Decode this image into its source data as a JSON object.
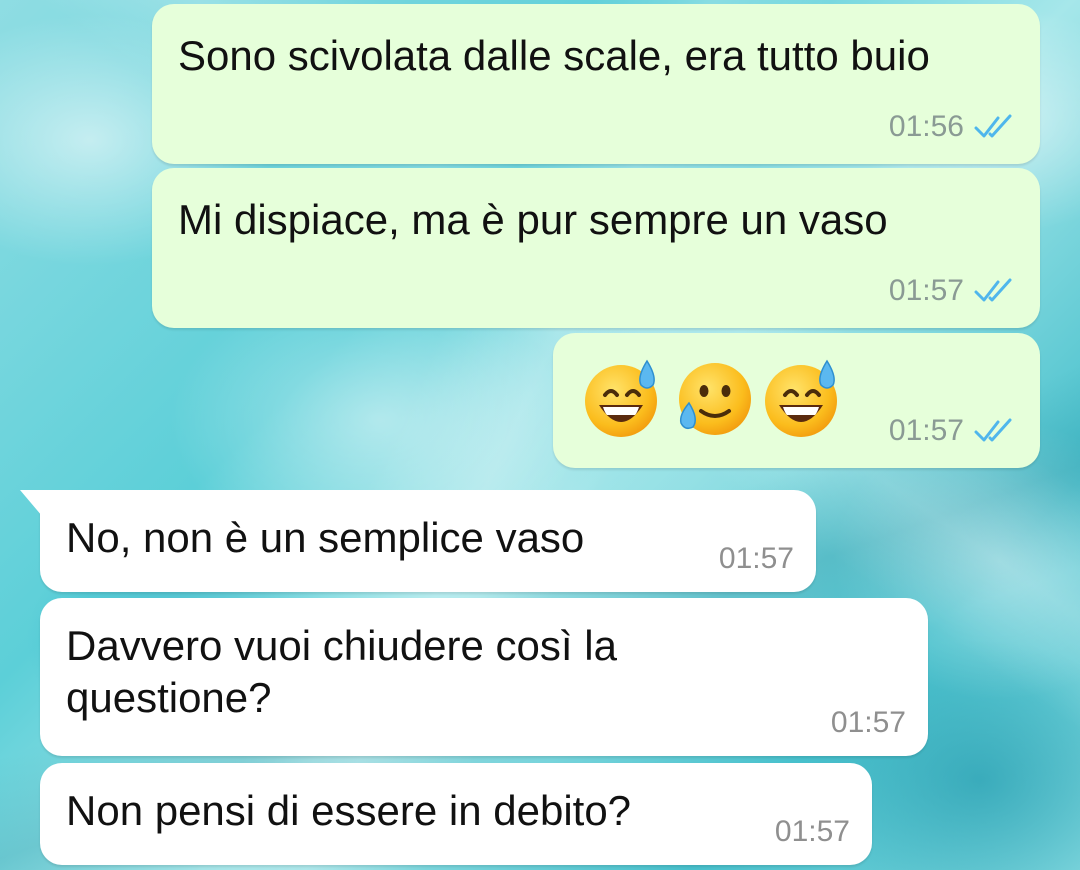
{
  "chat": {
    "messages": [
      {
        "direction": "outgoing",
        "text": "Sono scivolata dalle scale, era tutto buio",
        "time": "01:56",
        "status": "read",
        "status_icon": "double-check-icon"
      },
      {
        "direction": "outgoing",
        "text": "Mi dispiace, ma è pur sempre un vaso",
        "time": "01:57",
        "status": "read",
        "status_icon": "double-check-icon"
      },
      {
        "direction": "outgoing",
        "emojis": [
          "grinning-face-with-sweat-icon",
          "smiling-face-with-tear-icon",
          "grinning-face-with-sweat-icon"
        ],
        "time": "01:57",
        "status": "read",
        "status_icon": "double-check-icon"
      },
      {
        "direction": "incoming",
        "text": "No, non è un semplice vaso",
        "time": "01:57"
      },
      {
        "direction": "incoming",
        "text": "Davvero vuoi chiudere così la questione?",
        "time": "01:57"
      },
      {
        "direction": "incoming",
        "text": "Non pensi di essere in debito?",
        "time": "01:57"
      }
    ]
  },
  "colors": {
    "outgoing_bubble": "#e6ffda",
    "incoming_bubble": "#ffffff",
    "read_tick": "#4fb6ec",
    "timestamp": "#8a9a94",
    "wallpaper": "#5ccfd8"
  }
}
